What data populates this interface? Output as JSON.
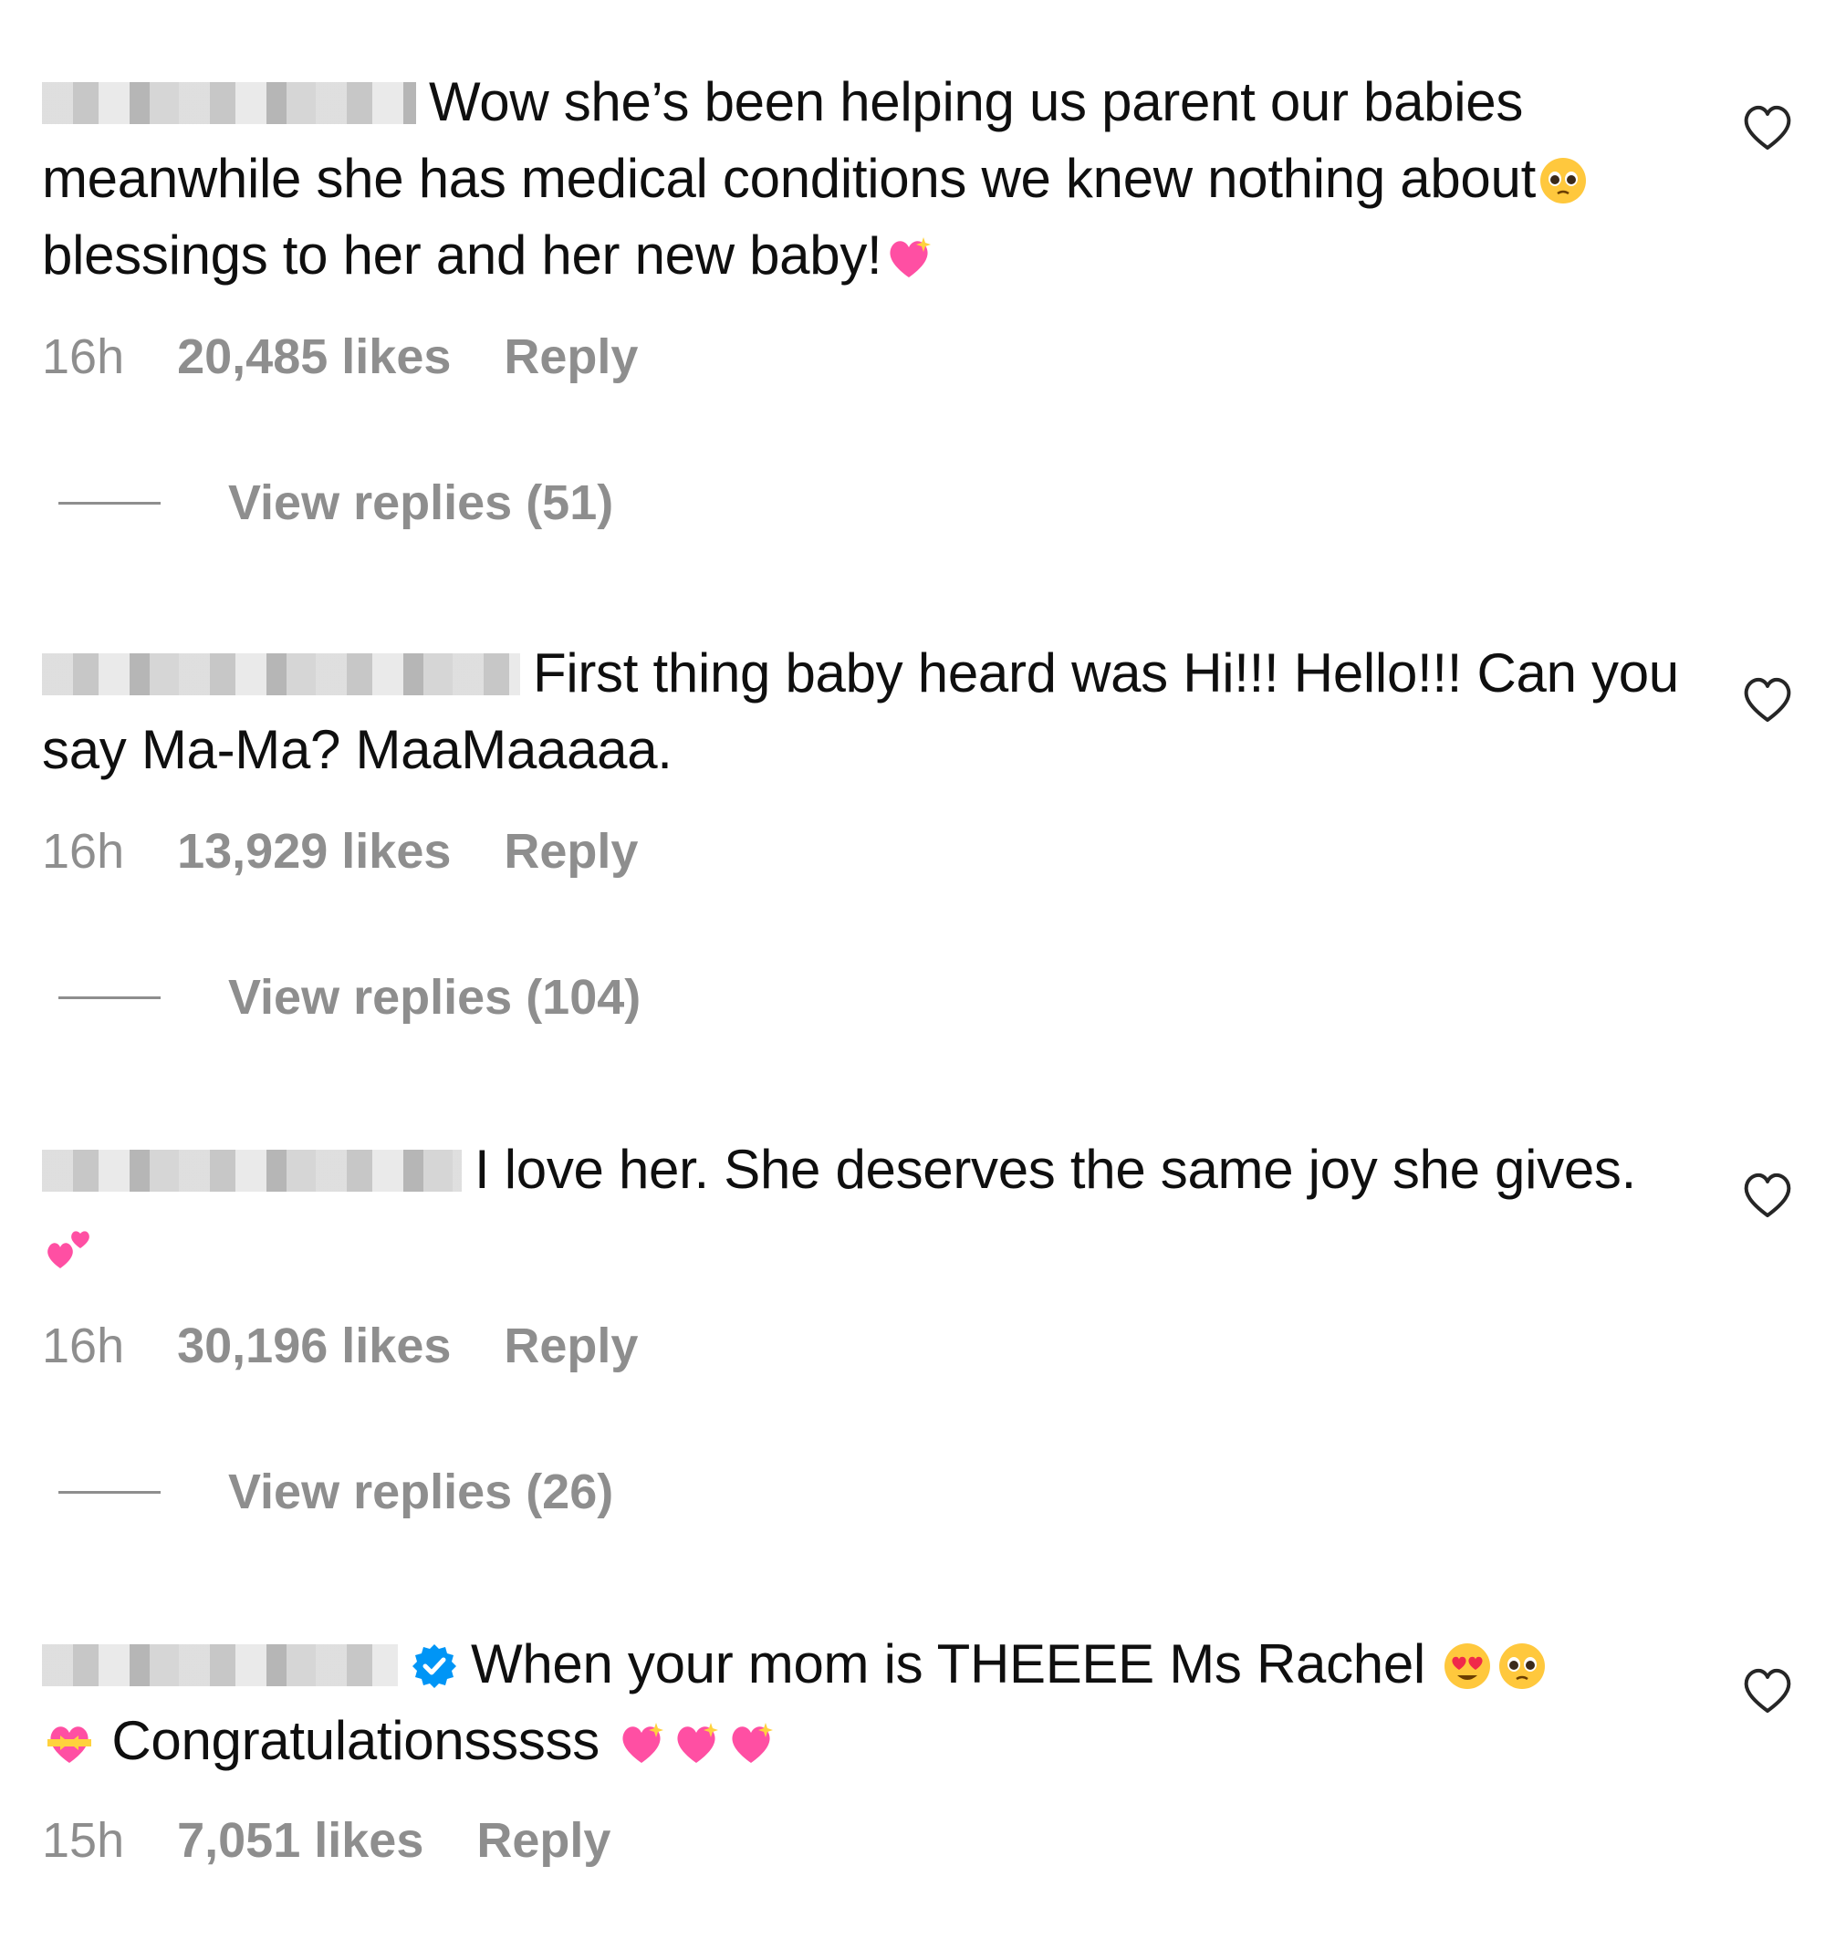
{
  "comments": [
    {
      "text_part1": "Wow she’s been helping us parent our babies meanwhile she has medical conditions we knew nothing about",
      "text_part2": " blessings to her and her new baby!",
      "emoji_1": "pleading-face-emoji",
      "emoji_2": "sparkling-heart-emoji",
      "time": "16h",
      "likes": "20,485 likes",
      "reply": "Reply",
      "view_replies": "View replies (51)"
    },
    {
      "text": "First thing baby heard was Hi!!! Hello!!! Can you say Ma-Ma? MaaMaaaaa.",
      "time": "16h",
      "likes": "13,929 likes",
      "reply": "Reply",
      "view_replies": "View replies (104)"
    },
    {
      "text": "I love her. She deserves the same joy she gives.",
      "emoji_1": "two-hearts-emoji",
      "time": "16h",
      "likes": "30,196 likes",
      "reply": "Reply",
      "view_replies": "View replies (26)"
    },
    {
      "text_part1": "When your mom is THEEEE Ms Rachel",
      "text_part2": "Congratulationsssss",
      "emoji_1": "heart-eyes-emoji",
      "emoji_2": "pleading-face-emoji",
      "emoji_3": "heart-with-ribbon-emoji",
      "emoji_4": "sparkling-heart-emoji",
      "verified_icon": "verified-badge-icon",
      "time": "15h",
      "likes": "7,051 likes",
      "reply": "Reply"
    }
  ],
  "icons": {
    "like": "heart-outline-icon"
  },
  "colors": {
    "text": "#0f0f0f",
    "meta": "#8e8e8e",
    "verified": "#0095f6",
    "emoji_pink": "#ff4fa3"
  }
}
